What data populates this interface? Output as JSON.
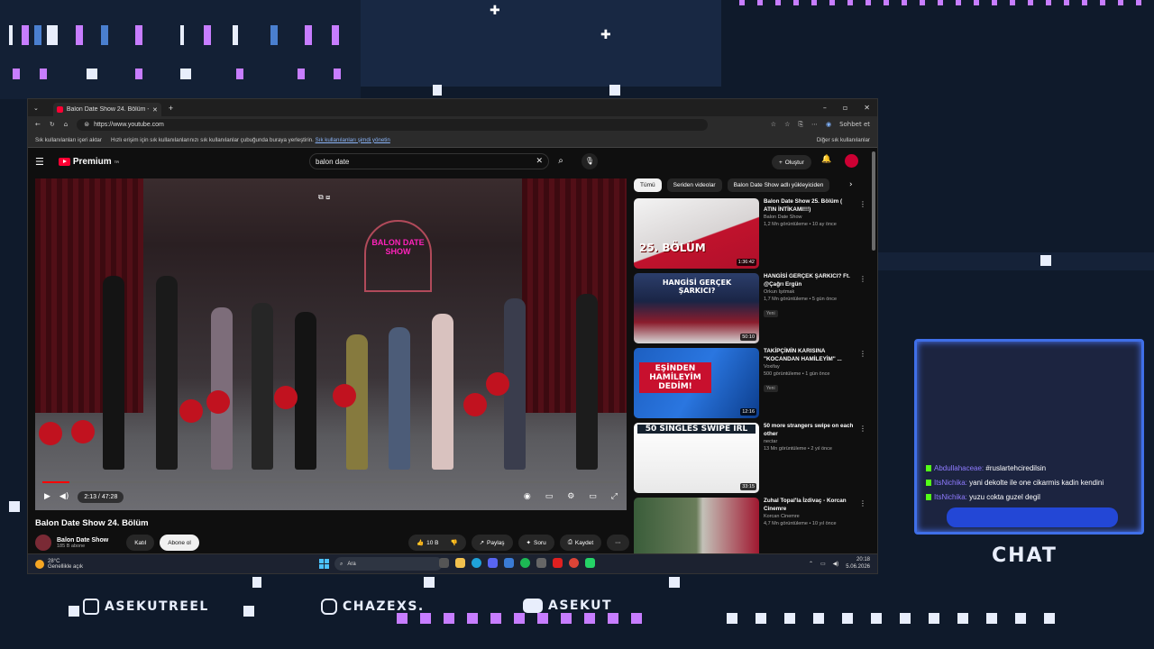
{
  "browser": {
    "tab_title": "Balon Date Show 24. Bölüm - You",
    "new_tab": "+",
    "url": "https://www.youtube.com",
    "favbar_first": "Sık kullanılanları içeri aktar",
    "favbar_text": "Hızlı erişim için sık kullanılanlarınızı sık kullanılanlar çubuğunda buraya yerleştirin.",
    "favbar_link": "Sık kullanılanları şimdi yönetin",
    "other_favorites": "Diğer sık kullanılanlar",
    "chat_button": "Sohbet et"
  },
  "youtube": {
    "logo": "Premium",
    "logo_tm": "TR",
    "search_value": "balon date",
    "create_label": "Oluştur"
  },
  "player": {
    "time": "2:13 / 47:28",
    "progress_fraction": 0.047,
    "sign_text": "BALON DATE SHOW"
  },
  "video": {
    "title": "Balon Date Show 24. Bölüm",
    "channel": "Balon Date Show",
    "subscribers": "185 B abone",
    "join": "Katıl",
    "subscribe": "Abone ol",
    "likes": "10 B",
    "share": "Paylaş",
    "ask": "Soru",
    "save": "Kaydet"
  },
  "chips": [
    "Tümü",
    "Seriden videolar",
    "Balon Date Show adlı yükleyiciden"
  ],
  "recs": [
    {
      "title": "Balon Date Show 25. Bölüm ( ATIN İNTİKAMI!!!)",
      "channel": "Balon Date Show",
      "meta": "1,2 Mn görüntüleme • 10 ay önce",
      "duration": "1:36:42",
      "thumb_text": "25. BÖLÜM",
      "badge": ""
    },
    {
      "title": "HANGİSİ GERÇEK ŞARKICI? Ft. @Çağrı Ergün",
      "channel": "Orkun Işıtmak",
      "meta": "1,7 Mn görüntüleme • 5 gün önce",
      "duration": "50:10",
      "thumb_text": "HANGİSİ GERÇEK ŞARKICI?",
      "badge": "Yeni"
    },
    {
      "title": "TAKİPÇİMİN KARISINA \"KOCANDAN HAMİLEYİM\" ...",
      "channel": "Voxifay",
      "meta": "500 görüntüleme • 1 gün önce",
      "duration": "12:16",
      "thumb_text": "EŞİNDEN HAMİLEYİM DEDİM!",
      "badge": "Yeni"
    },
    {
      "title": "50 more strangers swipe on each other",
      "channel": "nectar",
      "meta": "13 Mn görüntüleme • 2 yıl önce",
      "duration": "33:15",
      "thumb_text": "50 SINGLES SWIPE IRL",
      "badge": ""
    },
    {
      "title": "Zuhal Topal'la İzdivaç - Korcan Cinemre",
      "channel": "Korcan Cinemre",
      "meta": "4,7 Mn görüntüleme • 10 yıl önce",
      "duration": "",
      "thumb_text": "",
      "badge": ""
    }
  ],
  "taskbar": {
    "temp": "28°C",
    "weather": "Genellikle açık",
    "search": "Ara",
    "time": "20:18",
    "date": "5.06.2026"
  },
  "chat": {
    "title": "CHAT",
    "messages": [
      {
        "user": "Abdullahaceae:",
        "text": "#ruslartehciredilsin"
      },
      {
        "user": "ItsNichika:",
        "text": "yani dekolte ile one cikarmis kadin kendini"
      },
      {
        "user": "ItsNichika:",
        "text": "yuzu cokta guzel degil"
      }
    ]
  },
  "socials": {
    "instagram": "ASEKUTREEL",
    "discord": "CHAZEXS.",
    "youtube": "ASEKUT"
  }
}
